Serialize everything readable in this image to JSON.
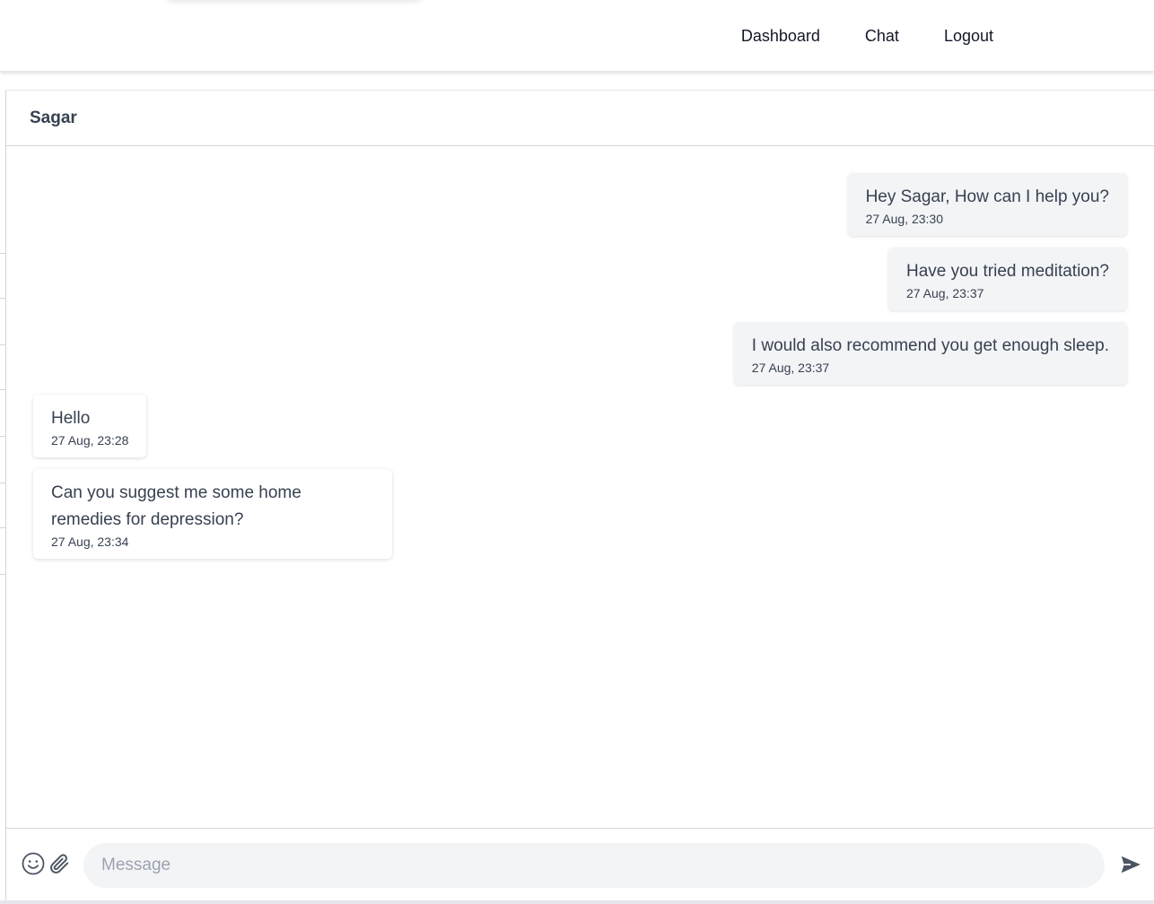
{
  "nav": {
    "items": [
      {
        "label": "Dashboard"
      },
      {
        "label": "Chat"
      },
      {
        "label": "Logout"
      }
    ]
  },
  "chat": {
    "contact_name": "Sagar",
    "messages": [
      {
        "direction": "out",
        "text": "Hey Sagar, How can I help you?",
        "time": "27 Aug, 23:30"
      },
      {
        "direction": "out",
        "text": "Have you tried meditation?",
        "time": "27 Aug, 23:37"
      },
      {
        "direction": "out",
        "text": "I would also recommend you get enough sleep.",
        "time": "27 Aug, 23:37"
      },
      {
        "direction": "in",
        "text": "Hello",
        "time": "27 Aug, 23:28"
      },
      {
        "direction": "in",
        "text": "Can you suggest me some home remedies for depression?",
        "time": "27 Aug, 23:34"
      }
    ]
  },
  "composer": {
    "placeholder": "Message",
    "value": "",
    "emoji_icon": "smiley-face-icon",
    "attach_icon": "paperclip-icon",
    "send_icon": "send-arrow-icon"
  },
  "colors": {
    "outgoing_bubble": "#f3f4f6",
    "incoming_bubble": "#ffffff",
    "text": "#374151",
    "input_bg": "#f3f4f6",
    "icon": "#4b5563"
  }
}
